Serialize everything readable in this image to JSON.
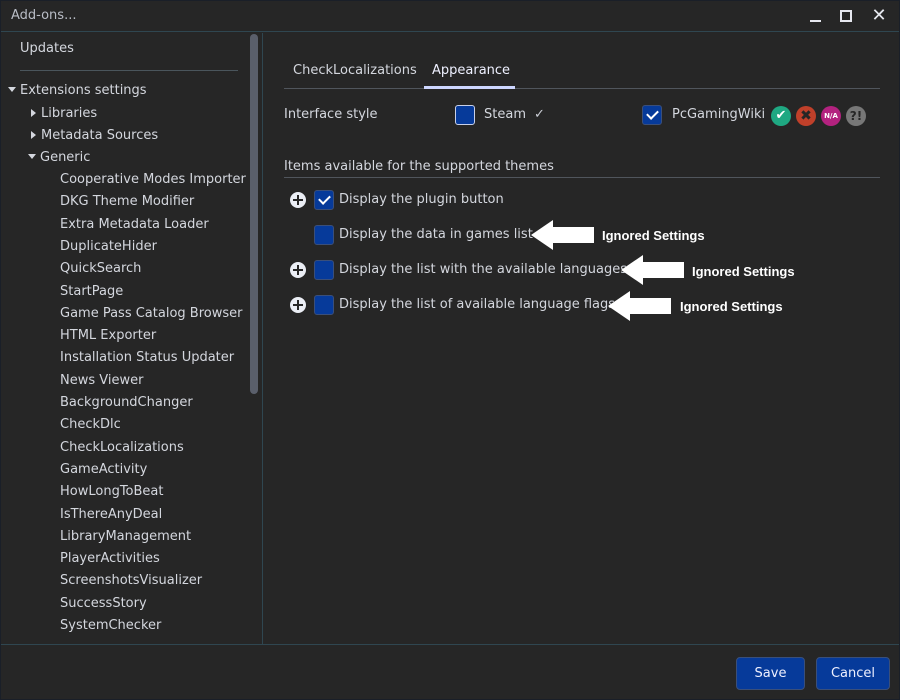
{
  "window": {
    "title": "Add-ons...",
    "controls": [
      "minimize",
      "maximize",
      "close"
    ]
  },
  "sidebar": {
    "updates_label": "Updates",
    "extensions_settings_label": "Extensions settings",
    "groups": [
      {
        "label": "Libraries",
        "expanded": false
      },
      {
        "label": "Metadata Sources",
        "expanded": false
      },
      {
        "label": "Generic",
        "expanded": true
      }
    ],
    "generic_items": [
      "Cooperative Modes Importer",
      "DKG Theme Modifier",
      "Extra Metadata Loader",
      "DuplicateHider",
      "QuickSearch",
      "StartPage",
      "Game Pass Catalog Browser",
      "HTML Exporter",
      "Installation Status Updater",
      "News Viewer",
      "BackgroundChanger",
      "CheckDlc",
      "CheckLocalizations",
      "GameActivity",
      "HowLongToBeat",
      "IsThereAnyDeal",
      "LibraryManagement",
      "PlayerActivities",
      "ScreenshotsVisualizer",
      "SuccessStory",
      "SystemChecker"
    ]
  },
  "tabs": [
    {
      "label": "CheckLocalizations",
      "active": false
    },
    {
      "label": "Appearance",
      "active": true
    }
  ],
  "interface_style": {
    "label": "Interface style",
    "options": [
      {
        "label": "Steam",
        "checked": false,
        "suffix": "✓"
      },
      {
        "label": "PcGamingWiki",
        "checked": true
      }
    ],
    "status_icons": [
      {
        "name": "check-icon",
        "glyph": "✔",
        "color": "#1fa882"
      },
      {
        "name": "cross-icon",
        "glyph": "✖",
        "color": "#c0402a"
      },
      {
        "name": "na-icon",
        "glyph": "N/A",
        "color": "#b3227f"
      },
      {
        "name": "unknown-icon",
        "glyph": "?!",
        "color": "#777777"
      }
    ]
  },
  "themes_section": {
    "title": "Items available for the supported themes",
    "items": [
      {
        "label": "Display the plugin button",
        "checked": true,
        "has_plus": true,
        "annotation": ""
      },
      {
        "label": "Display the data in games list",
        "checked": false,
        "has_plus": false,
        "annotation": "Ignored Settings"
      },
      {
        "label": "Display the list with the available languages",
        "checked": false,
        "has_plus": true,
        "annotation": "Ignored Settings"
      },
      {
        "label": "Display the list of available language flags",
        "checked": false,
        "has_plus": true,
        "annotation": "Ignored Settings"
      }
    ]
  },
  "footer": {
    "save_label": "Save",
    "cancel_label": "Cancel"
  },
  "colors": {
    "background": "#262626",
    "accent": "#063a9a",
    "tab_indicator": "#cdd6ff",
    "border": "#2f4650"
  }
}
